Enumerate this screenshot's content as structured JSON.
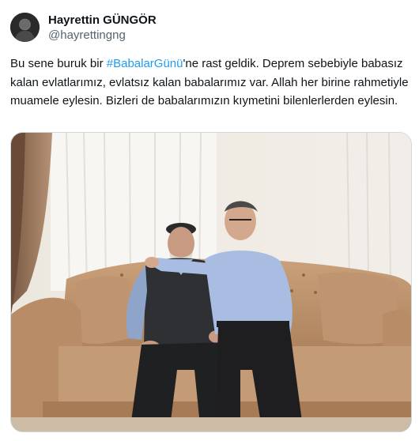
{
  "tweet": {
    "author": {
      "display_name": "Hayrettin GÜNGÖR",
      "handle": "@hayrettingng"
    },
    "text_before_hashtag": "Bu sene buruk bir ",
    "hashtag": "#BabalarGünü",
    "text_after_hashtag": "'ne rast geldik. Deprem sebebiyle babasız kalan evlatlarımız, evlatsız kalan babalarımız var. Allah her birine rahmetiyle muamele eylesin. Bizleri de babalarımızın kıymetini bilenlerlerden eylesin.",
    "media": {
      "icon": "photo-two-men-on-sofa"
    }
  },
  "colors": {
    "text": "#0f1419",
    "secondary_text": "#536471",
    "link": "#1d9bf0",
    "media_border": "#cfd9de"
  }
}
